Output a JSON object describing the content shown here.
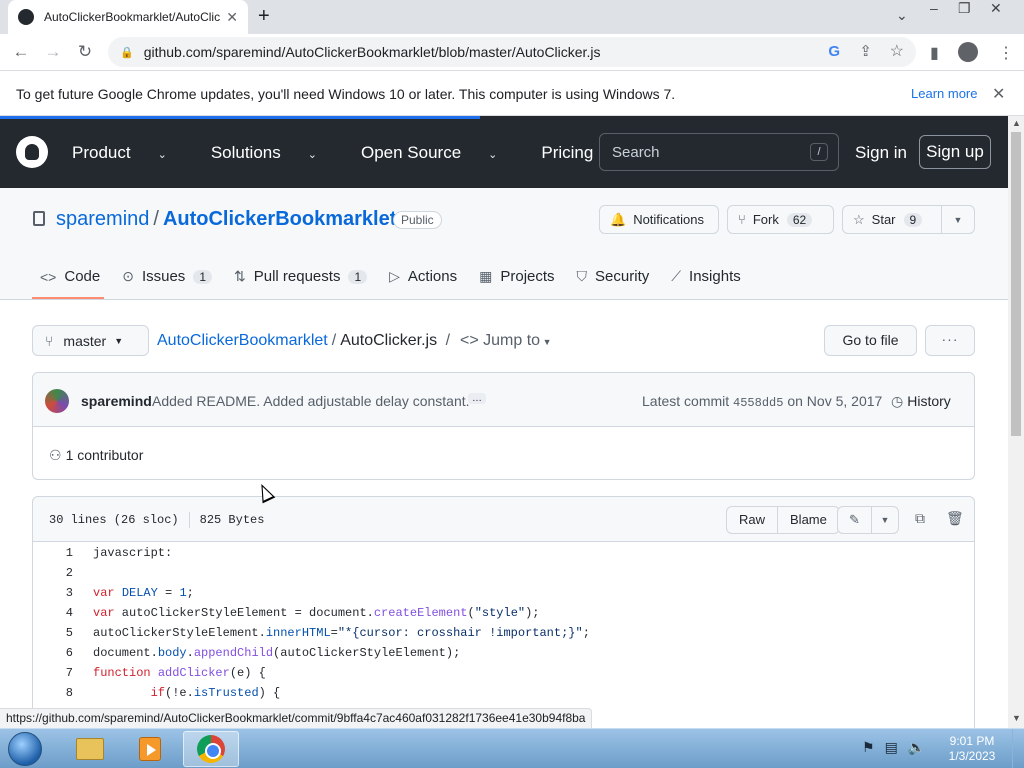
{
  "browser": {
    "tab_title": "AutoClickerBookmarklet/AutoClicker.js",
    "tab_close": "✕",
    "new_tab": "+",
    "url": "github.com/sparemind/AutoClickerBookmarklet/blob/master/AutoClicker.js",
    "status_url": "https://github.com/sparemind/AutoClickerBookmarklet/commit/9bffa4c7ac460af031282f1736ee41e30b94f8ba"
  },
  "infobar": {
    "message": "To get future Google Chrome updates, you'll need Windows 10 or later. This computer is using Windows 7.",
    "learn_more": "Learn more",
    "close": "✕"
  },
  "gh_header": {
    "nav": [
      "Product",
      "Solutions",
      "Open Source",
      "Pricing"
    ],
    "search_placeholder": "Search",
    "search_key": "/",
    "sign_in": "Sign in",
    "sign_up": "Sign up"
  },
  "repo": {
    "owner": "sparemind",
    "separator": "/",
    "name": "AutoClickerBookmarklet",
    "visibility": "Public",
    "notifications": "Notifications",
    "fork_label": "Fork",
    "fork_count": "62",
    "star_label": "Star",
    "star_count": "9",
    "tabs": [
      {
        "label": "Code",
        "count": ""
      },
      {
        "label": "Issues",
        "count": "1"
      },
      {
        "label": "Pull requests",
        "count": "1"
      },
      {
        "label": "Actions",
        "count": ""
      },
      {
        "label": "Projects",
        "count": ""
      },
      {
        "label": "Security",
        "count": ""
      },
      {
        "label": "Insights",
        "count": ""
      }
    ]
  },
  "filenav": {
    "branch": "master",
    "repo_link": "AutoClickerBookmarklet",
    "sep": "/",
    "file": "AutoClicker.js",
    "jump_to": "Jump to",
    "go_to_file": "Go to file",
    "more": "···"
  },
  "commit": {
    "author": "sparemind",
    "message": "Added README. Added adjustable delay constant.",
    "ellipsis": "…",
    "latest_label": "Latest commit",
    "sha": "4558dd5",
    "date": "on Nov 5, 2017",
    "history": "History",
    "contributors": "1 contributor"
  },
  "file": {
    "lines": "30 lines (26 sloc)",
    "size": "825 Bytes",
    "raw": "Raw",
    "blame": "Blame",
    "code": [
      {
        "n": "1",
        "text": "javascript:"
      },
      {
        "n": "2",
        "text": ""
      },
      {
        "n": "3",
        "text": "var DELAY = 1;"
      },
      {
        "n": "4",
        "text": "var autoClickerStyleElement = document.createElement(\"style\");"
      },
      {
        "n": "5",
        "text": "autoClickerStyleElement.innerHTML=\"*{cursor: crosshair !important;}\";"
      },
      {
        "n": "6",
        "text": "document.body.appendChild(autoClickerStyleElement);"
      },
      {
        "n": "7",
        "text": "function addClicker(e) {"
      },
      {
        "n": "8",
        "text": "        if(!e.isTrusted) {"
      }
    ]
  },
  "taskbar": {
    "time": "9:01 PM",
    "date": "1/3/2023"
  }
}
